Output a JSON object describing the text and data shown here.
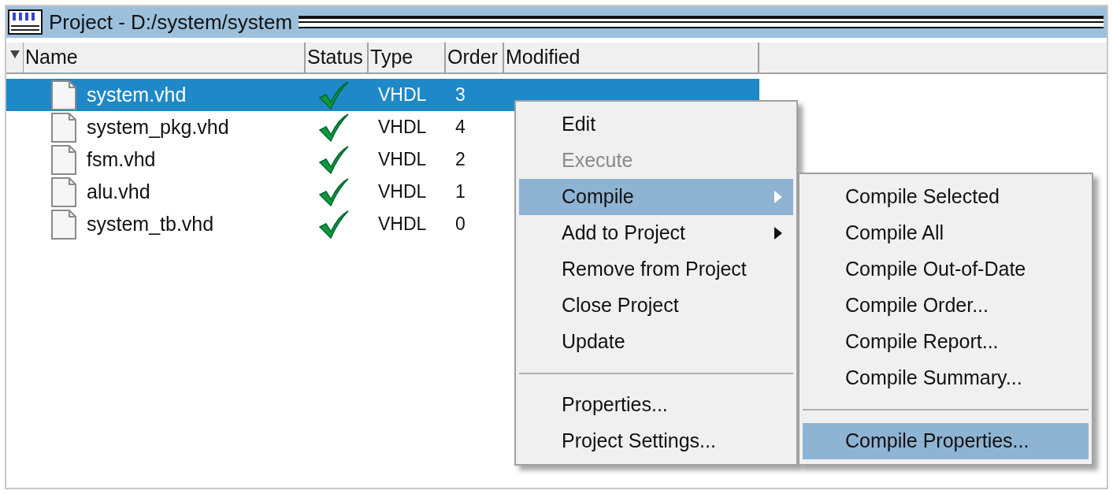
{
  "window": {
    "title": "Project - D:/system/system"
  },
  "table": {
    "columns": [
      {
        "label": "Name"
      },
      {
        "label": "Status"
      },
      {
        "label": "Type"
      },
      {
        "label": "Order"
      },
      {
        "label": "Modified"
      }
    ],
    "rows": [
      {
        "name": "system.vhd",
        "status_ok": true,
        "type": "VHDL",
        "order": "3",
        "selected": true
      },
      {
        "name": "system_pkg.vhd",
        "status_ok": true,
        "type": "VHDL",
        "order": "4",
        "selected": false
      },
      {
        "name": "fsm.vhd",
        "status_ok": true,
        "type": "VHDL",
        "order": "2",
        "selected": false
      },
      {
        "name": "alu.vhd",
        "status_ok": true,
        "type": "VHDL",
        "order": "1",
        "selected": false
      },
      {
        "name": "system_tb.vhd",
        "status_ok": true,
        "type": "VHDL",
        "order": "0",
        "selected": false
      }
    ]
  },
  "context_menu": {
    "items": [
      {
        "kind": "item",
        "label": "Edit",
        "disabled": false,
        "selected": false,
        "submenu": false
      },
      {
        "kind": "item",
        "label": "Execute",
        "disabled": true,
        "selected": false,
        "submenu": false
      },
      {
        "kind": "item",
        "label": "Compile",
        "disabled": false,
        "selected": true,
        "submenu": true
      },
      {
        "kind": "item",
        "label": "Add to Project",
        "disabled": false,
        "selected": false,
        "submenu": true
      },
      {
        "kind": "item",
        "label": "Remove from Project",
        "disabled": false,
        "selected": false,
        "submenu": false
      },
      {
        "kind": "item",
        "label": "Close Project",
        "disabled": false,
        "selected": false,
        "submenu": false
      },
      {
        "kind": "item",
        "label": "Update",
        "disabled": false,
        "selected": false,
        "submenu": false
      },
      {
        "kind": "separator"
      },
      {
        "kind": "item",
        "label": "Properties...",
        "disabled": false,
        "selected": false,
        "submenu": false
      },
      {
        "kind": "item",
        "label": "Project Settings...",
        "disabled": false,
        "selected": false,
        "submenu": false
      }
    ]
  },
  "submenu": {
    "items": [
      {
        "kind": "item",
        "label": "Compile Selected",
        "selected": false
      },
      {
        "kind": "item",
        "label": "Compile All",
        "selected": false
      },
      {
        "kind": "item",
        "label": "Compile Out-of-Date",
        "selected": false
      },
      {
        "kind": "item",
        "label": "Compile Order...",
        "selected": false
      },
      {
        "kind": "item",
        "label": "Compile Report...",
        "selected": false
      },
      {
        "kind": "item",
        "label": "Compile Summary...",
        "selected": false
      },
      {
        "kind": "separator"
      },
      {
        "kind": "item",
        "label": "Compile Properties...",
        "selected": true
      }
    ]
  }
}
